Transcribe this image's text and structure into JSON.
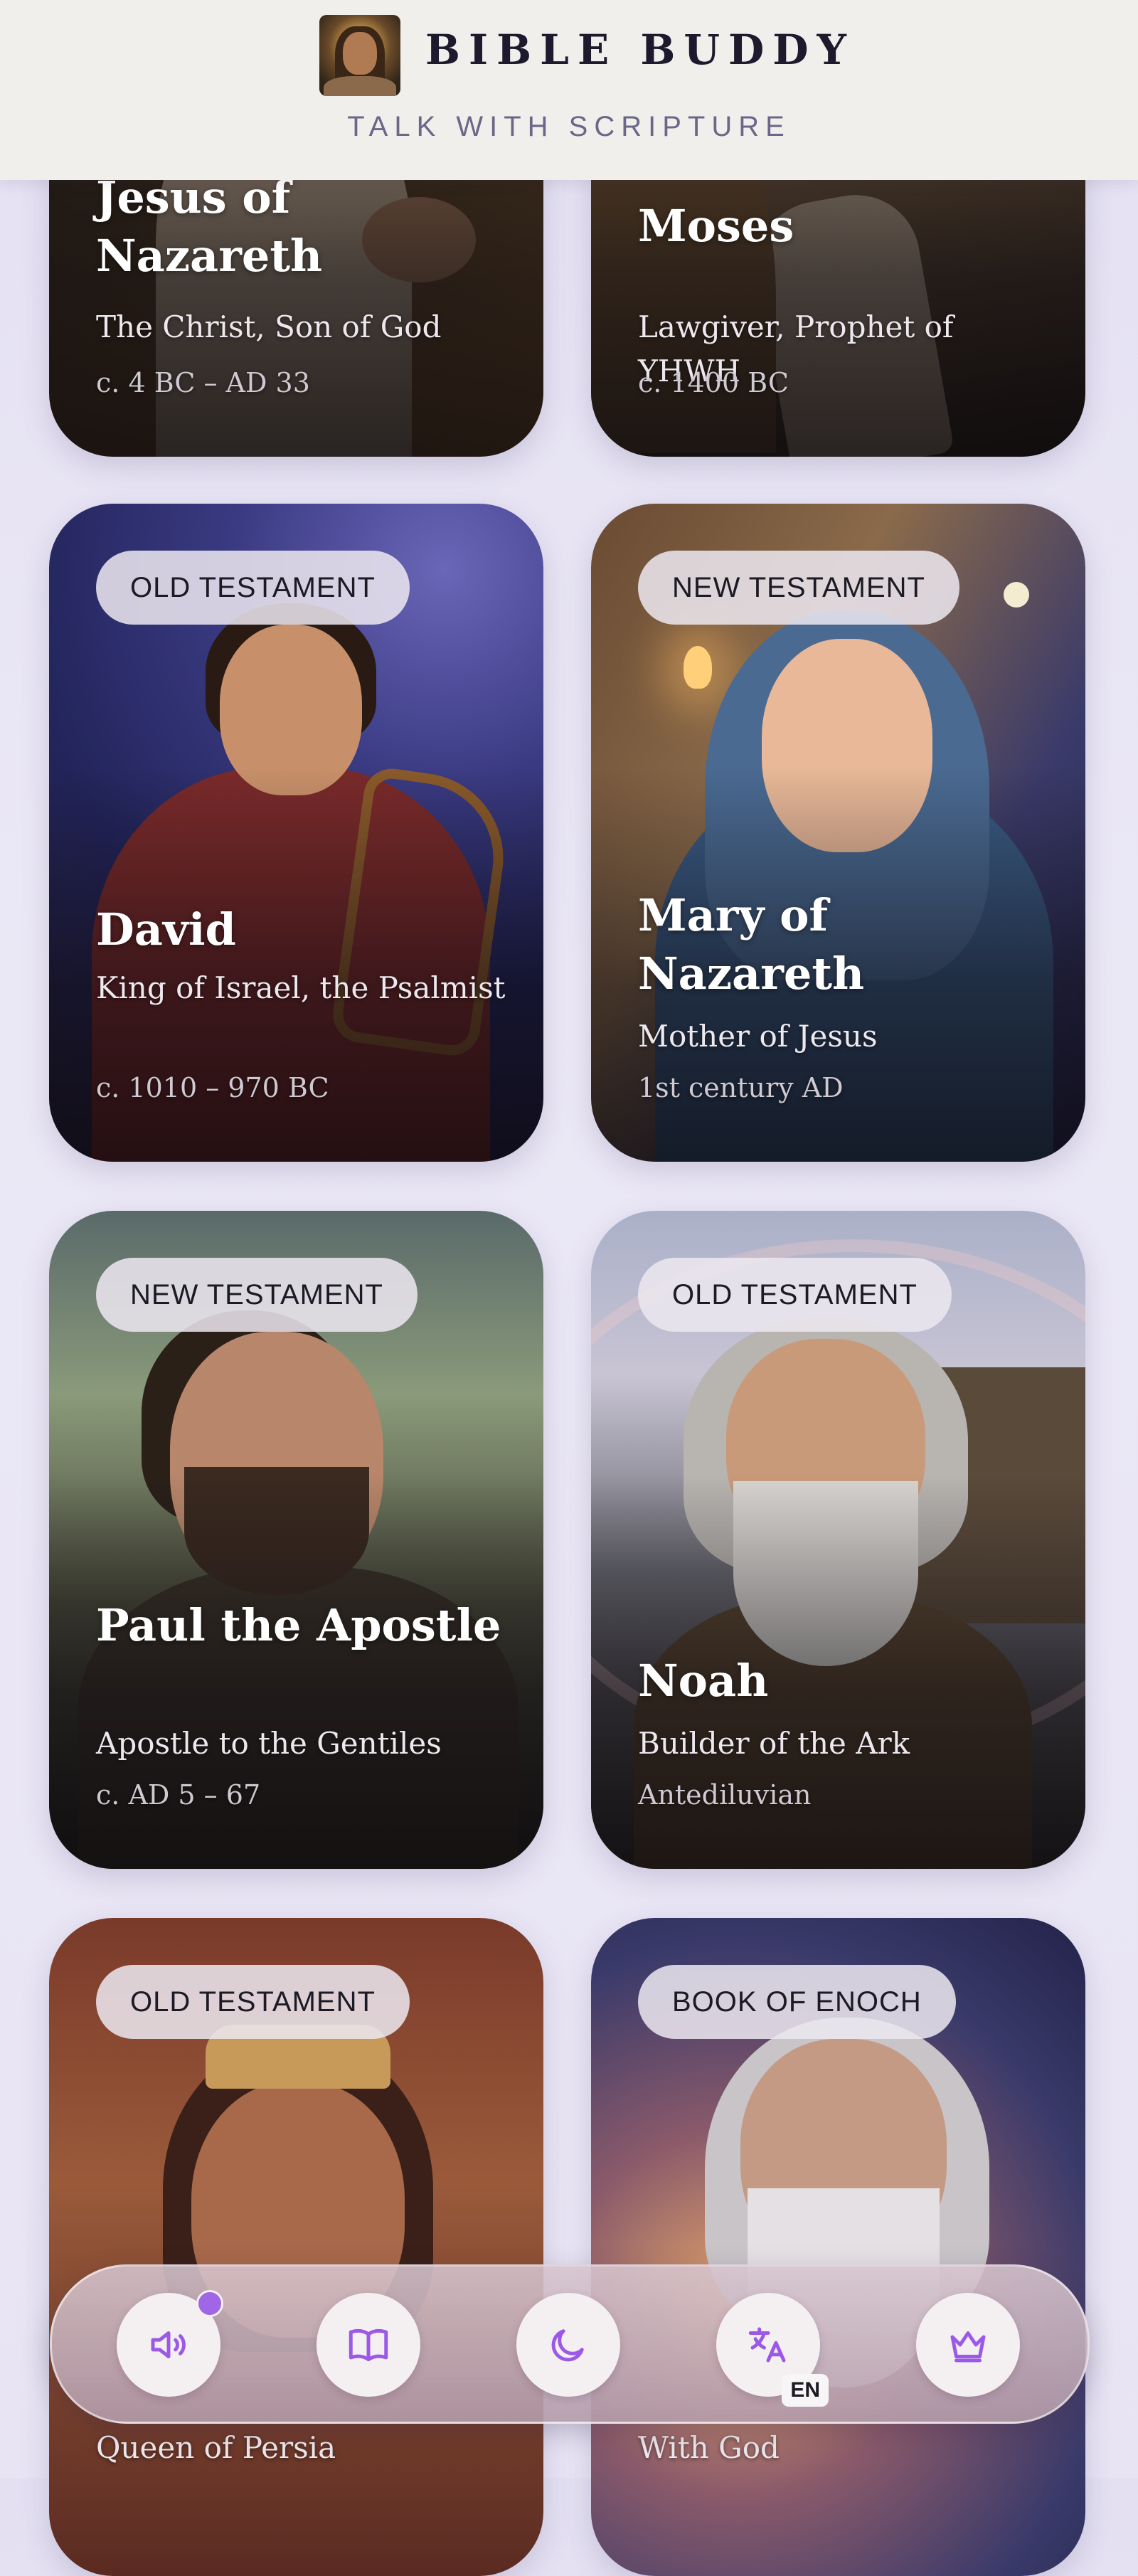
{
  "header": {
    "title": "BIBLE BUDDY",
    "subtitle": "TALK WITH SCRIPTURE"
  },
  "cards": [
    {
      "name": "Jesus of Nazareth",
      "role": "The Christ, Son of God",
      "era": "c. 4 BC – AD 33",
      "badge": ""
    },
    {
      "name": "Moses",
      "role": "Lawgiver, Prophet of YHWH",
      "era": "c. 1400 BC",
      "badge": ""
    },
    {
      "name": "David",
      "role": "King of Israel, the Psalmist",
      "era": "c. 1010 – 970 BC",
      "badge": "OLD TESTAMENT"
    },
    {
      "name": "Mary of Nazareth",
      "role": "Mother of Jesus",
      "era": "1st century AD",
      "badge": "NEW TESTAMENT"
    },
    {
      "name": "Paul the Apostle",
      "role": "Apostle to the Gentiles",
      "era": "c. AD 5 – 67",
      "badge": "NEW TESTAMENT"
    },
    {
      "name": "Noah",
      "role": "Builder of the Ark",
      "era": "Antediluvian",
      "badge": "OLD TESTAMENT"
    },
    {
      "name": "",
      "role": "Queen of Persia",
      "era": "",
      "badge": "OLD TESTAMENT"
    },
    {
      "name": "",
      "role": "With God",
      "era": "",
      "badge": "BOOK OF ENOCH"
    }
  ],
  "toolbar": {
    "items": [
      {
        "icon": "speaker-icon"
      },
      {
        "icon": "book-icon"
      },
      {
        "icon": "moon-icon"
      },
      {
        "icon": "translate-icon",
        "tag": "EN"
      },
      {
        "icon": "crown-icon"
      }
    ]
  },
  "colors": {
    "accent": "#9b59e6",
    "header_bg": "#f1efec",
    "page_bg": "#e8e4f4",
    "badge_bg": "#ece8f0",
    "notification_dot": "#a066e6"
  }
}
